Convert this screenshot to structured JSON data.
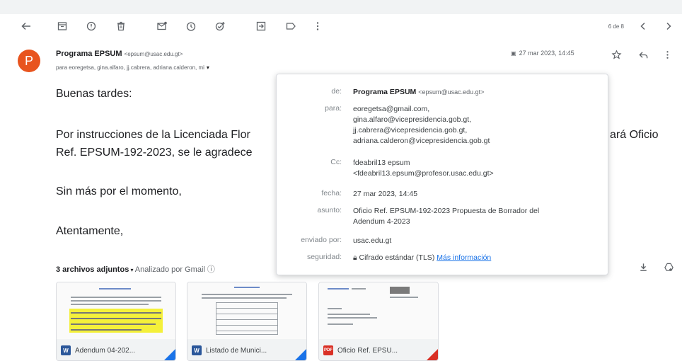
{
  "toolbar": {
    "pager": "6 de 8",
    "icons": [
      "back-arrow-icon",
      "archive-icon",
      "report-spam-icon",
      "delete-icon",
      "mark-unread-icon",
      "snooze-icon",
      "add-task-icon",
      "move-to-icon",
      "label-icon",
      "more-vert-icon",
      "newer-chevron-icon",
      "older-chevron-icon"
    ]
  },
  "message": {
    "avatar_letter": "P",
    "avatar_color": "#e8541e",
    "sender_name": "Programa EPSUM",
    "sender_email": "<epsum@usac.edu.gt>",
    "recipients_summary": "para eoregetsa, gina.alfaro, jj.cabrera, adriana.calderon, mi",
    "date": "27 mar 2023, 14:45"
  },
  "body": {
    "greeting": "Buenas tardes:",
    "line1_start": "Por instrucciones de la Licenciada Flor",
    "line1_end": "ará Oficio",
    "line2_start": "Ref. EPSUM-192-2023, se le agradece",
    "closing1": "Sin más por el momento,",
    "closing2": "Atentamente,"
  },
  "details_popup": {
    "de_label": "de:",
    "de_name": "Programa EPSUM",
    "de_email": "<epsum@usac.edu.gt>",
    "para_label": "para:",
    "para": [
      "eoregetsa@gmail.com,",
      "gina.alfaro@vicepresidencia.gob.gt,",
      "jj.cabrera@vicepresidencia.gob.gt,",
      "adriana.calderon@vicepresidencia.gob.gt"
    ],
    "cc_label": "Cc:",
    "cc": [
      "fdeabril13 epsum",
      "<fdeabril13.epsum@profesor.usac.edu.gt>"
    ],
    "fecha_label": "fecha:",
    "fecha": "27 mar 2023, 14:45",
    "asunto_label": "asunto:",
    "asunto": [
      "Oficio Ref. EPSUM-192-2023 Propuesta de Borrador del",
      "Adendum 4-2023"
    ],
    "enviado_label": "enviado por:",
    "enviado": "usac.edu.gt",
    "seguridad_label": "seguridad:",
    "seguridad": "Cifrado estándar (TLS)",
    "mas_info": "Más información"
  },
  "attachments": {
    "count_label": "3 archivos adjuntos",
    "scan_label": "Analizado por Gmail",
    "files": [
      {
        "name": "Adendum 04-202...",
        "badge": "W",
        "badge_color": "#2b579a",
        "corner_color": "#1a73e8"
      },
      {
        "name": "Listado de Munici...",
        "badge": "W",
        "badge_color": "#2b579a",
        "corner_color": "#1a73e8"
      },
      {
        "name": "Oficio Ref. EPSU...",
        "badge": "PDF",
        "badge_color": "#d93025",
        "corner_color": "#d93025"
      }
    ]
  }
}
